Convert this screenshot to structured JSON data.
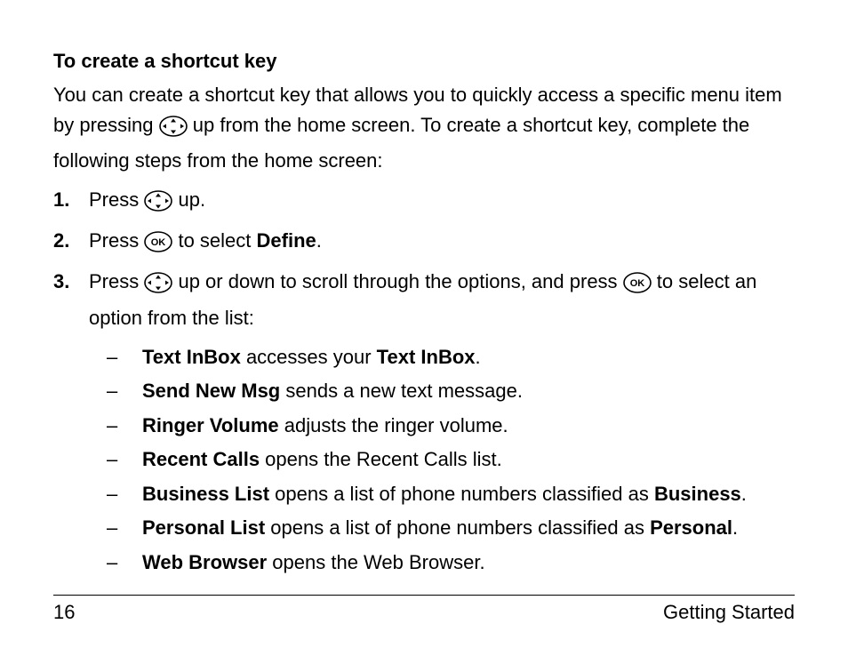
{
  "heading": "To create a shortcut key",
  "intro": {
    "pre": "You can create a shortcut key that allows you to quickly access a specific menu item by pressing ",
    "post_icon": " up from the home screen. To create a shortcut key, complete the following steps from the home screen:"
  },
  "steps": [
    {
      "num": "1.",
      "parts": [
        {
          "t": "Press "
        },
        {
          "icon": "nav"
        },
        {
          "t": " up."
        }
      ]
    },
    {
      "num": "2.",
      "parts": [
        {
          "t": "Press "
        },
        {
          "icon": "ok"
        },
        {
          "t": " to select "
        },
        {
          "b": "Define"
        },
        {
          "t": "."
        }
      ]
    },
    {
      "num": "3.",
      "parts": [
        {
          "t": "Press "
        },
        {
          "icon": "nav"
        },
        {
          "t": " up or down to scroll through the options, and press "
        },
        {
          "icon": "ok"
        },
        {
          "t": " to select an option from the list:"
        }
      ]
    }
  ],
  "sublist": [
    [
      {
        "b": "Text InBox"
      },
      {
        "t": " accesses your "
      },
      {
        "b": "Text InBox"
      },
      {
        "t": "."
      }
    ],
    [
      {
        "b": "Send New Msg"
      },
      {
        "t": " sends a new text message."
      }
    ],
    [
      {
        "b": "Ringer Volume"
      },
      {
        "t": " adjusts the ringer volume."
      }
    ],
    [
      {
        "b": "Recent Calls"
      },
      {
        "t": " opens the Recent Calls list."
      }
    ],
    [
      {
        "b": "Business List"
      },
      {
        "t": " opens a list of phone numbers classified as "
      },
      {
        "b": "Business"
      },
      {
        "t": "."
      }
    ],
    [
      {
        "b": "Personal List"
      },
      {
        "t": " opens a list of phone numbers classified as "
      },
      {
        "b": "Personal"
      },
      {
        "t": "."
      }
    ],
    [
      {
        "b": "Web Browser"
      },
      {
        "t": " opens the Web Browser."
      }
    ]
  ],
  "footer": {
    "page_num": "16",
    "section": "Getting Started"
  },
  "dash": "–"
}
